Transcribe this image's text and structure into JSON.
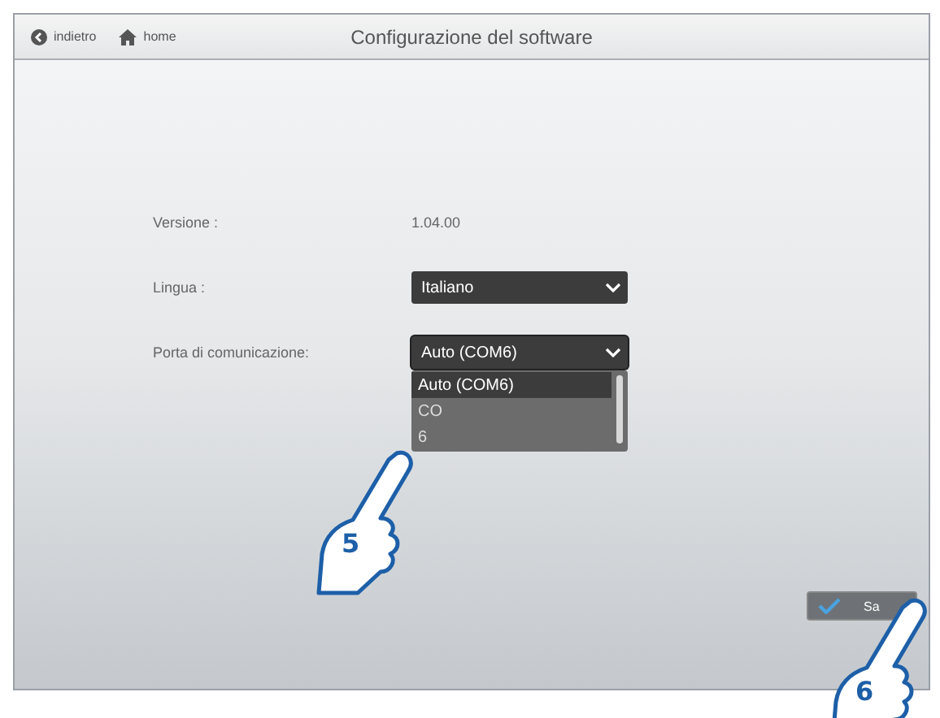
{
  "header": {
    "back": "indietro",
    "home": "home",
    "title": "Configurazione del software"
  },
  "fields": [
    {
      "kind": "text",
      "label": "Versione :",
      "value": "1.04.00"
    },
    {
      "kind": "select",
      "label": "Lingua :",
      "value": "Italiano",
      "open": false
    },
    {
      "kind": "select",
      "label": "Porta di comunicazione:",
      "value": "Auto (COM6)",
      "open": true,
      "options": [
        {
          "label": "Auto (COM6)",
          "selected": true
        },
        {
          "label": "CO",
          "selected": false
        },
        {
          "label": "6",
          "selected": false
        }
      ]
    }
  ],
  "save_button": {
    "label": "Sa"
  },
  "callouts": [
    {
      "number": "5"
    },
    {
      "number": "6"
    }
  ]
}
